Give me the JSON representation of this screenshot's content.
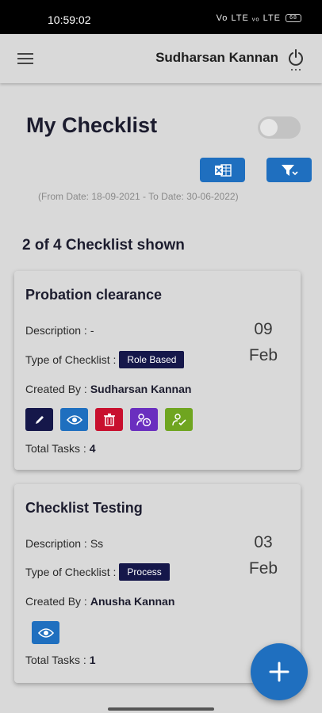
{
  "status_bar": {
    "time": "10:59:02",
    "icons": "Vo LTE  ᵥₒ LTE",
    "battery": "68"
  },
  "app_bar": {
    "user_name": "Sudharsan Kannan"
  },
  "page": {
    "title": "My Checklist",
    "date_range": "(From Date: 18-09-2021 - To Date: 30-06-2022)",
    "count_label": "2 of 4 Checklist shown"
  },
  "checklists": [
    {
      "title": "Probation clearance",
      "description_label": "Description :",
      "description": "-",
      "type_label": "Type of Checklist :",
      "type": "Role Based",
      "created_label": "Created By :",
      "created_by": "Sudharsan Kannan",
      "day": "09",
      "month": "Feb",
      "tasks_label": "Total Tasks :",
      "tasks": "4"
    },
    {
      "title": "Checklist Testing",
      "description_label": "Description :",
      "description": "Ss",
      "type_label": "Type of Checklist :",
      "type": "Process",
      "created_label": "Created By :",
      "created_by": "Anusha Kannan",
      "day": "03",
      "month": "Feb",
      "tasks_label": "Total Tasks :",
      "tasks": "1"
    }
  ],
  "colors": {
    "primary": "#1f6fbf",
    "navy": "#15174a",
    "danger": "#c8102e",
    "purple": "#6a2fbf",
    "green": "#6fa520"
  }
}
